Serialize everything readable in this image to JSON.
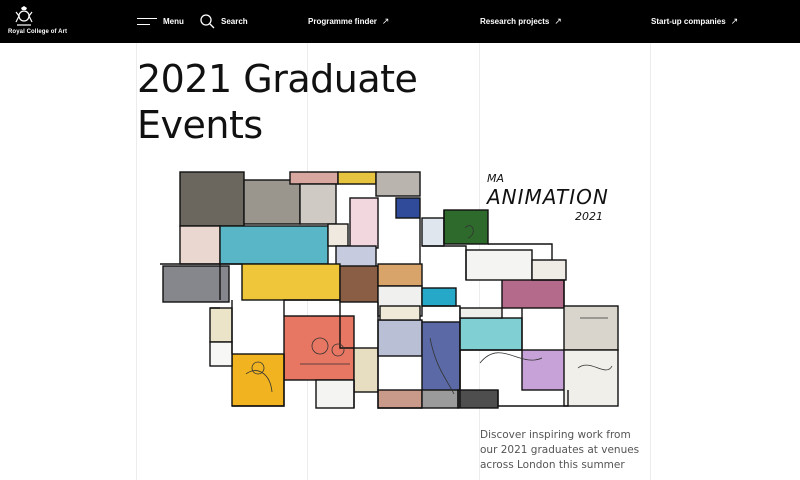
{
  "header": {
    "logo_text": "Royal College of Art",
    "menu_label": "Menu",
    "search_label": "Search",
    "links": [
      {
        "label": "Programme finder",
        "icon": "external-arrow-icon"
      },
      {
        "label": "Research projects",
        "icon": "external-arrow-icon"
      },
      {
        "label": "Start-up companies",
        "icon": "external-arrow-icon"
      }
    ]
  },
  "page": {
    "title_line1": "2021 Graduate",
    "title_line2": "Events",
    "hero_text": {
      "line1": "MA",
      "line2": "ANIMATION",
      "line3": "2021"
    },
    "caption": "Discover inspiring work from our 2021 graduates at venues across London this summer"
  },
  "colors": {
    "header_bg": "#000000",
    "header_text": "#ffffff",
    "page_bg": "#ffffff",
    "caption_text": "#555555"
  }
}
